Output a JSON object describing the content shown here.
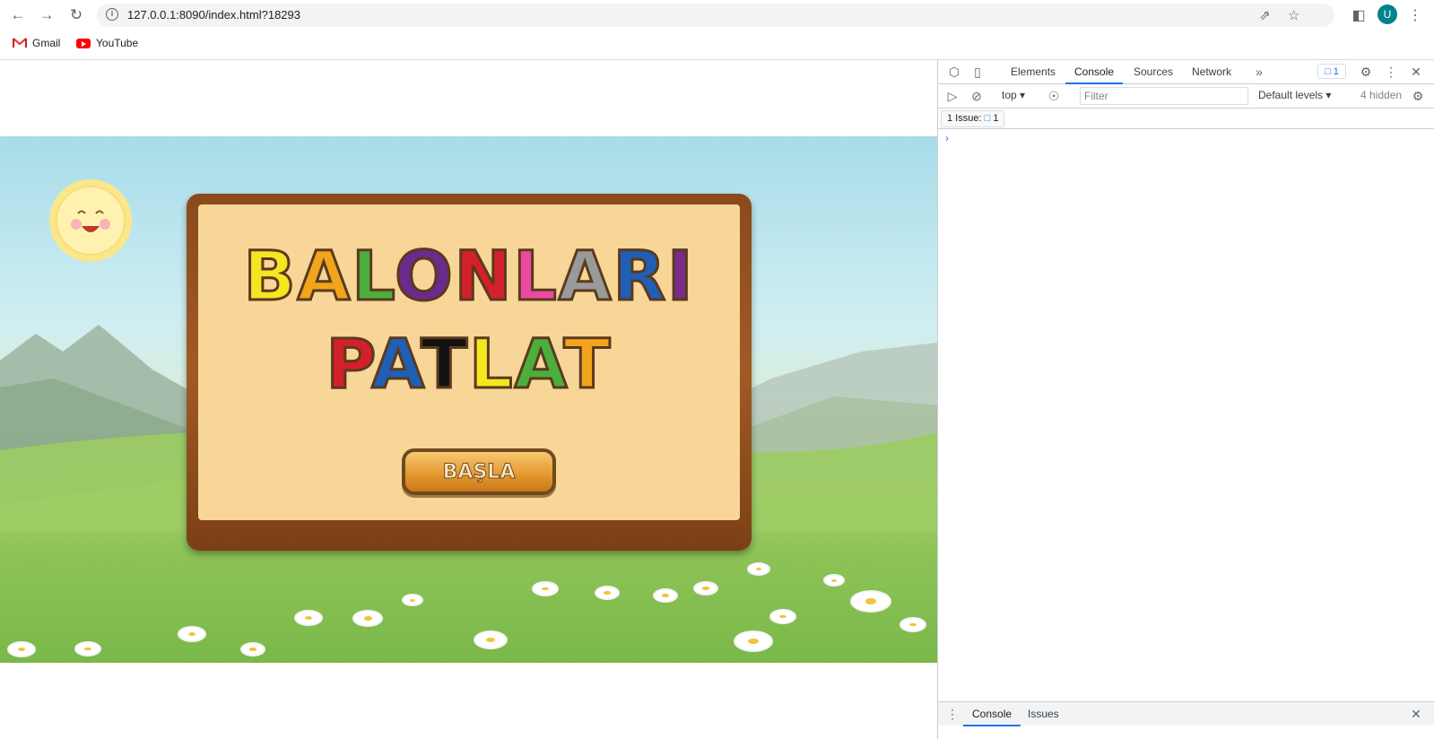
{
  "browser": {
    "url": "127.0.0.1:8090/index.html?18293",
    "avatar_letter": "U",
    "bookmarks": [
      {
        "label": "Gmail",
        "icon": "gmail-icon"
      },
      {
        "label": "YouTube",
        "icon": "youtube-icon"
      }
    ]
  },
  "game": {
    "title_line1": [
      "B",
      "A",
      "L",
      "O",
      "N",
      "L",
      "A",
      "R",
      "I"
    ],
    "title_line1_colors": [
      "#f5e622",
      "#f2a41c",
      "#4cae3c",
      "#6b2a8c",
      "#d4202a",
      "#ec4aa0",
      "#9a9a9a",
      "#1f5fb6",
      "#7a2a8a"
    ],
    "title_line2": [
      "P",
      "A",
      "T",
      "L",
      "A",
      "T"
    ],
    "title_line2_colors": [
      "#d4202a",
      "#1f5fb6",
      "#111111",
      "#f2e81c",
      "#4cae3c",
      "#f2a41c"
    ],
    "start_label": "BAŞLA"
  },
  "devtools": {
    "tabs": [
      "Elements",
      "Console",
      "Sources",
      "Network"
    ],
    "active_tab": "Console",
    "issues_badge": "1",
    "context": "top",
    "filter_placeholder": "Filter",
    "levels": "Default levels",
    "hidden": "4 hidden",
    "issues_label": "1 Issue:",
    "issues_count": "1",
    "prompt": "›",
    "drawer_tabs": [
      "Console",
      "Issues"
    ]
  }
}
